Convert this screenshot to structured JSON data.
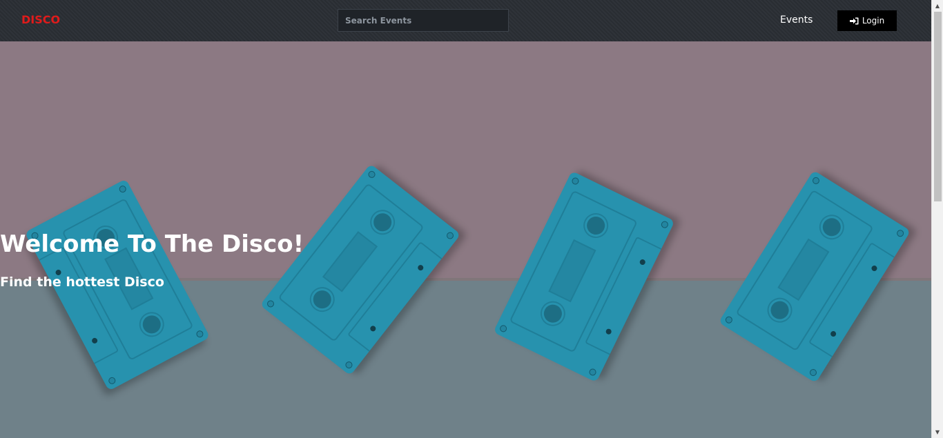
{
  "navbar": {
    "brand": "DISCO",
    "search": {
      "placeholder": "Search Events",
      "value": ""
    },
    "events_link": "Events",
    "login_button": {
      "label": "Login",
      "icon": "sign-in-icon"
    }
  },
  "hero": {
    "title": "Welcome To The Disco!",
    "subtitle": "Find the hottest Disco",
    "image": "teal-cassette-tapes"
  },
  "colors": {
    "brand": "#e01b1b",
    "navbar_bg": "#2a2e34",
    "login_bg": "#000000",
    "wall": "#8c7983",
    "floor": "#6f8189",
    "cassette": "#2792ae"
  },
  "scrollbar": {
    "position_fraction": 0.0
  }
}
